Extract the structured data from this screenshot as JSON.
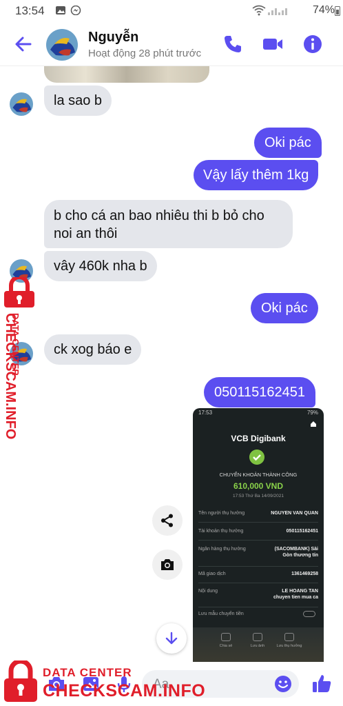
{
  "status_bar": {
    "time": "13:54",
    "battery": "74%"
  },
  "header": {
    "name": "Nguyễn",
    "active_status": "Hoạt động 28 phút trước"
  },
  "messages": [
    {
      "side": "in",
      "text": "la sao b"
    },
    {
      "side": "out",
      "text": "Oki pác"
    },
    {
      "side": "out",
      "text": "Vậy lấy thêm 1kg"
    },
    {
      "side": "in",
      "text_line1": "b cho cá an bao nhiêu thi b bỏ cho",
      "text_line2": "noi an thôi"
    },
    {
      "side": "in",
      "text": "vây 460k nha b"
    },
    {
      "side": "out",
      "text": "Oki  pác"
    },
    {
      "side": "in",
      "text": "ck xog báo e"
    },
    {
      "side": "out",
      "text": "050115162451"
    }
  ],
  "receipt": {
    "status_time": "17:53",
    "status_battery": "79%",
    "brand": "VCB Digibank",
    "result": "CHUYỂN KHOẢN THÀNH CÔNG",
    "amount": "610,000 VND",
    "datetime": "17:53 Thứ Ba 14/09/2021",
    "rows": [
      {
        "label": "Tên người thụ hưởng",
        "value": "NGUYEN VAN QUAN"
      },
      {
        "label": "Tài khoản thụ hưởng",
        "value": "050115162451"
      },
      {
        "label": "Ngân hàng thụ hưởng",
        "value": "(SACOMBANK) Sài",
        "value2": "Gòn thương tín"
      },
      {
        "label": "Mã giao dịch",
        "value": "1361469258"
      },
      {
        "label": "Nội dung",
        "value": "LE HOANG TAN",
        "value2": "chuyen tien mua ca"
      },
      {
        "label": "Lưu mẫu chuyển tiền",
        "value": ""
      }
    ],
    "footer": [
      "Chia sẻ",
      "Lưu ảnh",
      "Lưu thụ hưởng"
    ]
  },
  "composer": {
    "placeholder": "Aa"
  },
  "watermark": {
    "line1": "DATA CENTER",
    "line2": "CHECKSCAM.INFO"
  },
  "colors": {
    "accent": "#5b4ef0",
    "incoming": "#e4e6eb",
    "watermark": "#e01e2a",
    "receipt_green": "#8ad24a"
  }
}
